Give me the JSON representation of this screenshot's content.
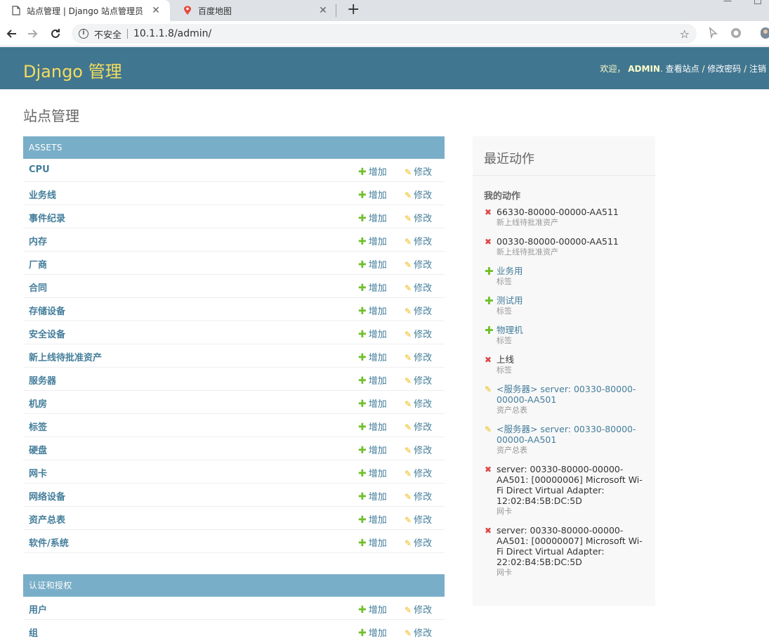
{
  "browser": {
    "tabs": [
      {
        "title": "站点管理 | Django 站点管理员",
        "close": "✕"
      },
      {
        "title": "百度地图",
        "close": "✕"
      }
    ],
    "new_tab": "+",
    "insecure_label": "不安全",
    "url": "10.1.1.8/admin/"
  },
  "header": {
    "brand": "Django 管理",
    "welcome": "欢迎，",
    "username": "ADMIN",
    "view_site": "查看站点",
    "change_password": "修改密码",
    "logout": "注销",
    "sep": " / "
  },
  "page_title": "站点管理",
  "add_label": "增加",
  "change_label": "修改",
  "modules": [
    {
      "caption": "ASSETS",
      "models": [
        "CPU",
        "业务线",
        "事件纪录",
        "内存",
        "厂商",
        "合同",
        "存储设备",
        "安全设备",
        "新上线待批准资产",
        "服务器",
        "机房",
        "标签",
        "硬盘",
        "网卡",
        "网络设备",
        "资产总表",
        "软件/系统"
      ]
    },
    {
      "caption": "认证和授权",
      "models": [
        "用户",
        "组"
      ]
    }
  ],
  "recent_actions": {
    "title": "最近动作",
    "subtitle": "我的动作",
    "items": [
      {
        "kind": "delete",
        "name": "66330-80000-00000-AA511",
        "type": "新上线待批准资产"
      },
      {
        "kind": "delete",
        "name": "00330-80000-00000-AA511",
        "type": "新上线待批准资产"
      },
      {
        "kind": "add",
        "name": "业务用",
        "type": "标签"
      },
      {
        "kind": "add",
        "name": "测试用",
        "type": "标签"
      },
      {
        "kind": "add",
        "name": "物理机",
        "type": "标签"
      },
      {
        "kind": "delete",
        "name": "上线",
        "type": "标签"
      },
      {
        "kind": "change",
        "name": "<服务器> server: 00330-80000-00000-AA501",
        "type": "资产总表"
      },
      {
        "kind": "change",
        "name": "<服务器> server: 00330-80000-00000-AA501",
        "type": "资产总表"
      },
      {
        "kind": "delete",
        "name": "server: 00330-80000-00000-AA501: [00000006] Microsoft Wi-Fi Direct Virtual Adapter: 12:02:B4:5B:DC:5D",
        "type": "网卡"
      },
      {
        "kind": "delete",
        "name": "server: 00330-80000-00000-AA501: [00000007] Microsoft Wi-Fi Direct Virtual Adapter: 22:02:B4:5B:DC:5D",
        "type": "网卡"
      }
    ]
  },
  "colors": {
    "header_bg": "#417690",
    "brand": "#f5dd5d",
    "caption_bg": "#79aec8",
    "link": "#447e9b",
    "add_green": "#70bf2b",
    "change_yellow": "#efb80b",
    "delete_red": "#dd4646"
  }
}
